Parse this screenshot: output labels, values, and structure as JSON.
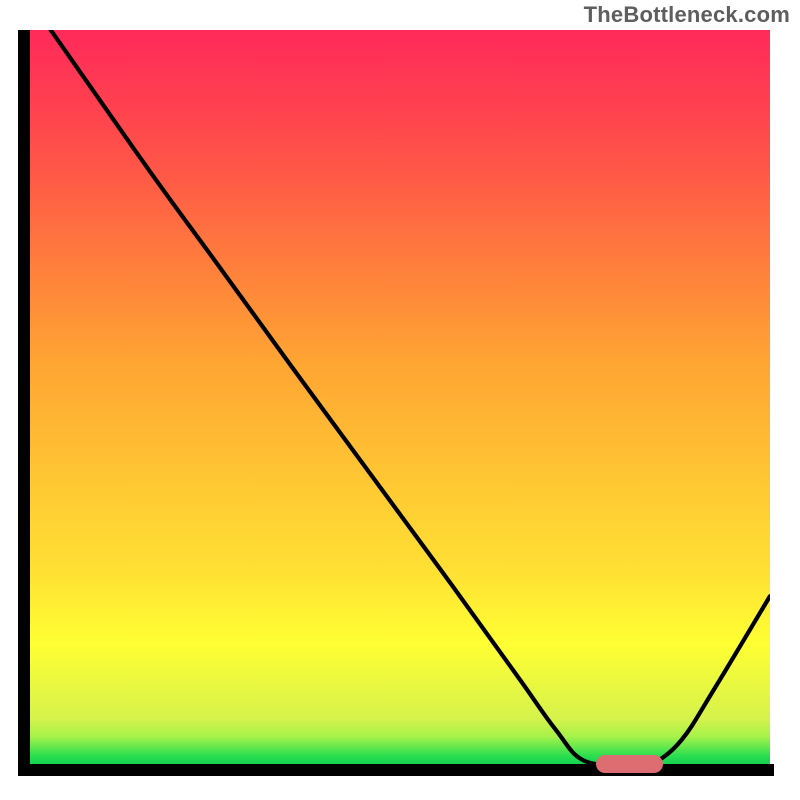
{
  "watermark": "TheBottleneck.com",
  "chart_data": {
    "type": "line",
    "title": "",
    "xlabel": "",
    "ylabel": "",
    "xlim": [
      0,
      100
    ],
    "ylim": [
      0,
      100
    ],
    "gradient_axis": "y",
    "gradient_stops": [
      {
        "pos": 0.0,
        "color": "#00C851"
      },
      {
        "pos": 0.02,
        "color": "#2EDF4F"
      },
      {
        "pos": 0.045,
        "color": "#A6F24A"
      },
      {
        "pos": 0.07,
        "color": "#D6F24B"
      },
      {
        "pos": 0.17,
        "color": "#FFFF33"
      },
      {
        "pos": 0.27,
        "color": "#FFE033"
      },
      {
        "pos": 0.35,
        "color": "#FFD033"
      },
      {
        "pos": 0.55,
        "color": "#FFA533"
      },
      {
        "pos": 0.68,
        "color": "#FF7F3C"
      },
      {
        "pos": 0.8,
        "color": "#FF5A46"
      },
      {
        "pos": 0.9,
        "color": "#FF4050"
      },
      {
        "pos": 1.0,
        "color": "#FF2A5A"
      }
    ],
    "series": [
      {
        "name": "bottleneck-curve",
        "x": [
          0.0,
          7.0,
          14.0,
          19.0,
          24.5,
          35.0,
          46.0,
          57.0,
          66.0,
          71.0,
          75.0,
          81.5,
          84.0,
          88.0,
          92.5,
          100.0
        ],
        "y": [
          104.0,
          94.0,
          84.0,
          77.0,
          69.5,
          55.0,
          40.0,
          25.0,
          12.5,
          5.5,
          1.2,
          0.8,
          0.8,
          4.0,
          11.0,
          23.5
        ]
      }
    ],
    "marker": {
      "name": "optimal-range",
      "x_start": 76.5,
      "x_end": 85.5,
      "y": 0.8,
      "color": "#DD6D70"
    }
  }
}
